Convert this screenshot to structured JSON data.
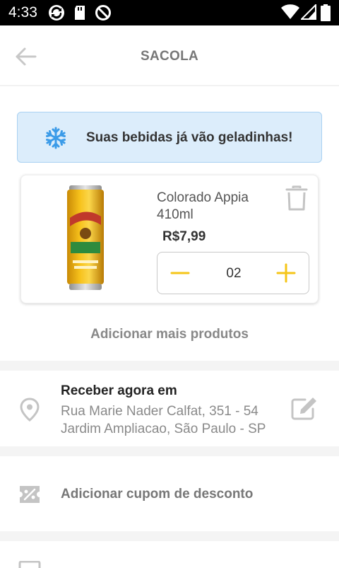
{
  "status_bar": {
    "time": "4:33"
  },
  "header": {
    "title": "SACOLA"
  },
  "banner": {
    "text": "Suas bebidas já vão geladinhas!",
    "icon": "snowflake-icon"
  },
  "cart": {
    "items": [
      {
        "name": "Colorado Appia 410ml",
        "price": "R$7,99",
        "quantity": "02"
      }
    ],
    "add_more_label": "Adicionar mais produtos"
  },
  "delivery": {
    "label": "Receber agora em",
    "address_line1": "Rua Marie Nader Calfat, 351 - 54",
    "address_line2": "Jardim Ampliacao, São Paulo - SP"
  },
  "coupon": {
    "label": "Adicionar cupom de desconto"
  },
  "colors": {
    "accent": "#f5c518",
    "banner_bg": "#dcedfb",
    "snowflake": "#3b9be8",
    "icon_gray": "#c4c4c4"
  }
}
